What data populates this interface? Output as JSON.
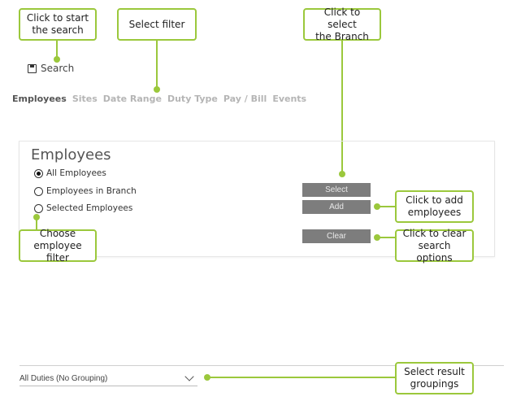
{
  "callouts": {
    "start_search": "Click to start\nthe search",
    "select_filter": "Select filter",
    "select_branch": "Click to select\nthe Branch",
    "add_employees": "Click to add\nemployees",
    "clear_search": "Click to clear\nsearch options",
    "choose_filter": "Choose\nemployee filter",
    "result_groupings": "Select result\ngroupings"
  },
  "toolbar": {
    "search_label": "Search"
  },
  "tabs": [
    {
      "label": "Employees",
      "active": true
    },
    {
      "label": "Sites"
    },
    {
      "label": "Date Range"
    },
    {
      "label": "Duty Type"
    },
    {
      "label": "Pay / Bill"
    },
    {
      "label": "Events"
    }
  ],
  "panel": {
    "title": "Employees",
    "options": [
      {
        "label": "All Employees",
        "checked": true
      },
      {
        "label": "Employees in Branch",
        "checked": false
      },
      {
        "label": "Selected Employees",
        "checked": false
      }
    ],
    "buttons": {
      "select": "Select",
      "add": "Add",
      "clear": "Clear"
    }
  },
  "grouping": {
    "selected": "All Duties (No Grouping)"
  },
  "colors": {
    "accent": "#9bc83c",
    "button_gray": "#7d7d7d"
  }
}
